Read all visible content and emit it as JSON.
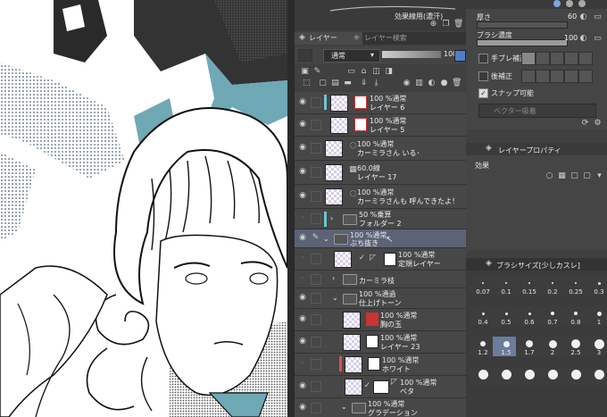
{
  "brush_strip": {
    "name": "効果線用(濃汗)"
  },
  "layer_panel": {
    "tab_layer": "レイヤー",
    "tab_layer_search": "レイヤー検索",
    "blend_mode": "通常",
    "opacity_value": "100",
    "layers": [
      {
        "mode": "100 %通常",
        "name": "レイヤー 6",
        "tag": "#6ec6d2"
      },
      {
        "mode": "100 %通常",
        "name": "レイヤー 5",
        "tag": ""
      },
      {
        "mode": "100 %通常",
        "name": "カーミラさん いる･",
        "tag": ""
      },
      {
        "mode": "60.0線",
        "name": "レイヤー 17",
        "tag": ""
      },
      {
        "mode": "100 %通常",
        "name": "カーミラさんも 呼んできたよ！",
        "tag": ""
      },
      {
        "mode": "50 %乗算",
        "name": "フォルダー 2",
        "tag": "#6ec6d2"
      },
      {
        "mode": "100 %通常",
        "name": "ぶち抜き",
        "tag": ""
      },
      {
        "mode": "100 %通常",
        "name": "定規レイヤー",
        "tag": ""
      },
      {
        "mode": "",
        "name": "カーミラ枝",
        "tag": ""
      },
      {
        "mode": "100 %通過",
        "name": "仕上げトーン",
        "tag": ""
      },
      {
        "mode": "100 %通常",
        "name": "胸の玉",
        "tag": ""
      },
      {
        "mode": "100 %通常",
        "name": "レイヤー 23",
        "tag": ""
      },
      {
        "mode": "100 %通常",
        "name": "ホワイト",
        "tag": "#e05050"
      },
      {
        "mode": "100 %通常",
        "name": "ベタ",
        "tag": ""
      },
      {
        "mode": "100 %通常",
        "name": "グラデーション",
        "tag": ""
      }
    ]
  },
  "tool_property": {
    "thickness_label": "厚さ",
    "thickness_value": "60",
    "brush_density_label": "ブラシ濃度",
    "brush_density_value": "100",
    "stabilization_label": "手ブレ補正",
    "post_correction_label": "後補正",
    "snap_label": "スナップ可能",
    "vector_erase_label": "ベクター吸着"
  },
  "layer_property": {
    "title": "レイヤープロパティ",
    "effect_label": "効果"
  },
  "brush_size": {
    "title": "ブラシサイズ[少しカスレ]",
    "sizes": [
      "0.07",
      "0.1",
      "0.15",
      "0.2",
      "0.25",
      "0.3",
      "0.4",
      "0.5",
      "0.6",
      "0.7",
      "0.8",
      "1",
      "1.2",
      "1.5",
      "1.7",
      "2",
      "2.5",
      "3",
      "",
      "",
      "",
      "",
      "",
      ""
    ]
  }
}
